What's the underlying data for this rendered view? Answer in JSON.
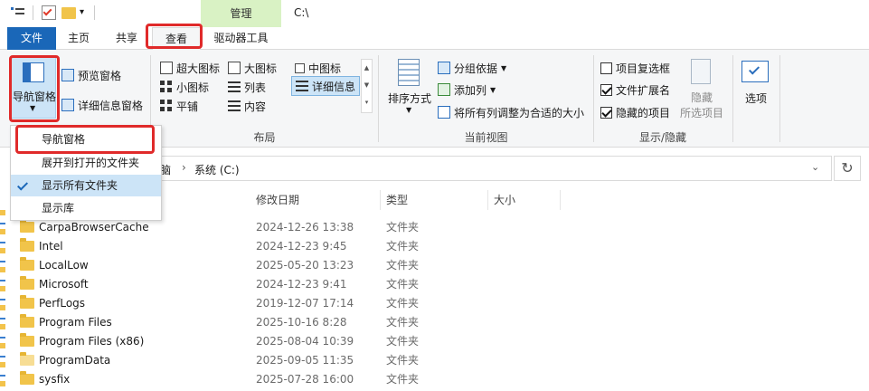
{
  "window": {
    "path_title": "C:\\"
  },
  "titlebar": {
    "manage_label": "管理"
  },
  "tabs": [
    {
      "label": "文件"
    },
    {
      "label": "主页"
    },
    {
      "label": "共享"
    },
    {
      "label": "查看"
    },
    {
      "label": "驱动器工具"
    }
  ],
  "ribbon": {
    "panes": {
      "nav_pane": "导航窗格",
      "preview_pane": "预览窗格",
      "details_pane": "详细信息窗格"
    },
    "layout": {
      "label": "布局",
      "items": [
        "超大图标",
        "大图标",
        "中图标",
        "小图标",
        "列表",
        "详细信息",
        "平铺",
        "内容"
      ],
      "selected": "详细信息"
    },
    "current_view": {
      "label": "当前视图",
      "sort_by": "排序方式",
      "group_by": "分组依据",
      "add_column": "添加列",
      "fit_columns": "将所有列调整为合适的大小"
    },
    "show_hide": {
      "label": "显示/隐藏",
      "item_checkboxes": {
        "label": "项目复选框",
        "checked": false
      },
      "file_extensions": {
        "label": "文件扩展名",
        "checked": true
      },
      "hidden_items": {
        "label": "隐藏的项目",
        "checked": true
      },
      "hide_selected": "隐藏",
      "selected_items": "所选项目"
    },
    "options": "选项"
  },
  "nav_menu": {
    "items": [
      {
        "label": "导航窗格",
        "checked": false
      },
      {
        "label": "展开到打开的文件夹",
        "checked": false
      },
      {
        "label": "显示所有文件夹",
        "checked": true
      },
      {
        "label": "显示库",
        "checked": false
      }
    ]
  },
  "address": {
    "crumb_partial": "脑",
    "crumb_current": "系统 (C:)"
  },
  "columns": [
    "修改日期",
    "类型",
    "大小"
  ],
  "files": [
    {
      "name": "CarpaBrowserCache",
      "date": "2024-12-26 13:38",
      "type": "文件夹"
    },
    {
      "name": "Intel",
      "date": "2024-12-23 9:45",
      "type": "文件夹"
    },
    {
      "name": "LocalLow",
      "date": "2025-05-20 13:23",
      "type": "文件夹"
    },
    {
      "name": "Microsoft",
      "date": "2024-12-23 9:41",
      "type": "文件夹"
    },
    {
      "name": "PerfLogs",
      "date": "2019-12-07 17:14",
      "type": "文件夹"
    },
    {
      "name": "Program Files",
      "date": "2025-10-16 8:28",
      "type": "文件夹"
    },
    {
      "name": "Program Files (x86)",
      "date": "2025-08-04 10:39",
      "type": "文件夹"
    },
    {
      "name": "ProgramData",
      "date": "2025-09-05 11:35",
      "type": "文件夹"
    },
    {
      "name": "sysfix",
      "date": "2025-07-28 16:00",
      "type": "文件夹"
    }
  ],
  "colors": {
    "accent": "#1a67b8",
    "highlight_box": "#e02a2a",
    "manage_tab": "#d9f2c4"
  }
}
